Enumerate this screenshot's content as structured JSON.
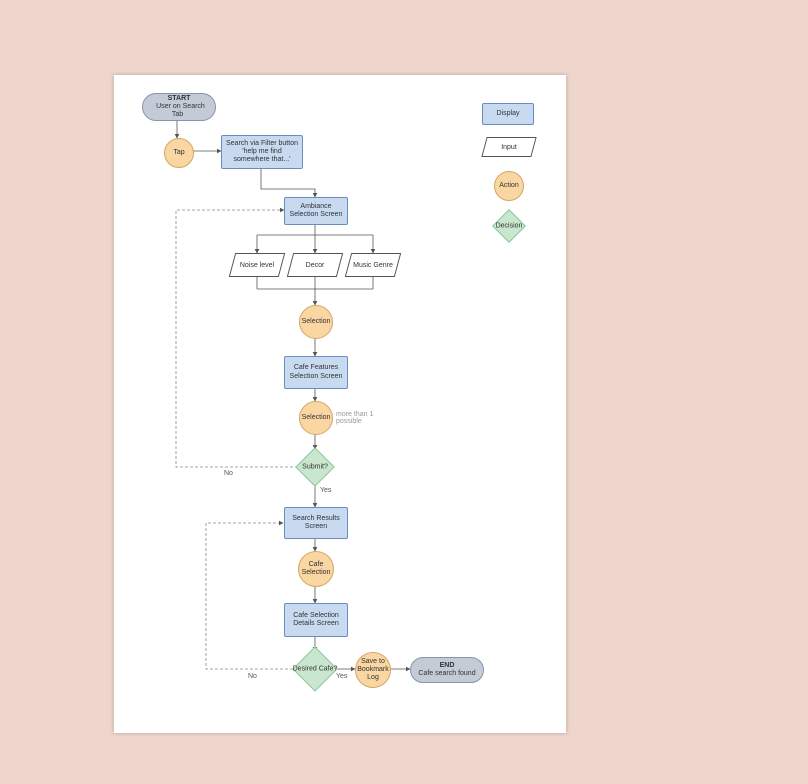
{
  "chart_data": {
    "type": "flowchart",
    "start": {
      "title": "START",
      "subtitle": "User on Search Tab"
    },
    "end": {
      "title": "END",
      "subtitle": "Cafe search found"
    },
    "nodes": {
      "tap": "Tap",
      "search_filter": "Search via Filter button 'help me find somewhere that...'",
      "ambiance": "Ambiance Selection Screen",
      "noise": "Noise level",
      "decor": "Decor",
      "music": "Music Genre",
      "selection1": "Selection",
      "cafe_features": "Cafe Features Selection Screen",
      "selection2": "Selection",
      "selection2_note": "more than 1 possible",
      "submit": "Submit?",
      "submit_no": "No",
      "submit_yes": "Yes",
      "results": "Search Results Screen",
      "cafe_sel": "Cafe Selection",
      "details": "Cafe Selection Details Screen",
      "desired": "Desired Cafe?",
      "desired_no": "No",
      "desired_yes": "Yes",
      "save": "Save to Bookmark Log"
    },
    "legend": {
      "display": "Display",
      "input": "Input",
      "action": "Action",
      "decision": "Decision"
    }
  }
}
